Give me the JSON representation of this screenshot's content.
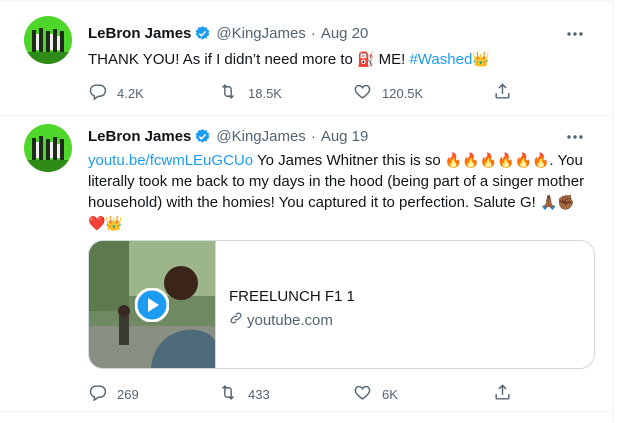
{
  "tweets": [
    {
      "name": "LeBron James",
      "handle": "@KingJames",
      "date": "Aug 20",
      "text_parts": {
        "a": "THANK YOU! As if I didn’t need more to ",
        "b": " ME! ",
        "hashtag": "#Washed"
      },
      "emojis": {
        "fuel": "⛽",
        "crown": "👑"
      },
      "stats": {
        "replies": "4.2K",
        "retweets": "18.5K",
        "likes": "120.5K"
      }
    },
    {
      "name": "LeBron James",
      "handle": "@KingJames",
      "date": "Aug 19",
      "link": "youtu.be/fcwmLEuGCUo",
      "text_parts": {
        "a": " Yo James Whitner this is so ",
        "b": ". You literally took me back to my days in the hood (being part of a singer mother household) with the homies! You captured it to perfection. Salute G! "
      },
      "emojis": {
        "fires": "🔥🔥🔥🔥🔥🔥",
        "end": "🙏🏾✊🏾❤️👑"
      },
      "card": {
        "title": "FREELUNCH F1 1",
        "domain": "youtube.com"
      },
      "stats": {
        "replies": "269",
        "retweets": "433",
        "likes": "6K"
      }
    }
  ],
  "colors": {
    "accent": "#1d9bf0",
    "muted": "#536471",
    "border": "#eff3f4"
  },
  "icons": [
    "verified-badge-icon",
    "more-icon",
    "reply-icon",
    "retweet-icon",
    "like-icon",
    "share-icon",
    "play-icon",
    "link-icon"
  ]
}
